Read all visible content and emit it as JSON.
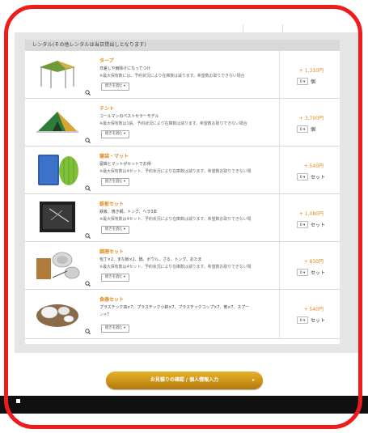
{
  "section": {
    "header": "レンタル(その他レンタルは当日貸出しとなります)"
  },
  "items": [
    {
      "title": "タープ",
      "desc": "日差しや雨除けになってつけ",
      "note": "※最大保有数には、予約状況により在庫数は減ります。希望数お取りできない場合",
      "more_label": "続きを読む ▾",
      "price": "+ 1,310円",
      "qty": "0",
      "unit": "個",
      "image_icon": "tarp-tent-icon"
    },
    {
      "title": "テント",
      "desc": "コールマンのベストセラーモデル",
      "note": "※最大保有数は1張、予約状況により在庫数は減ります。希望数お取りできない場合",
      "more_label": "続きを読む ▾",
      "price": "+ 3,700円",
      "qty": "0",
      "unit": "個",
      "image_icon": "dome-tent-icon"
    },
    {
      "title": "寝袋・マット",
      "desc": "寝袋とマットがセットでお得",
      "note": "※最大保有数は4セット、予約状況により在庫数は減ります。希望数お取りできない場",
      "more_label": "続きを読む ▾",
      "price": "+ 540円",
      "qty": "0",
      "unit": "セット",
      "image_icon": "sleeping-bag-icon"
    },
    {
      "title": "鉄板セット",
      "desc": "鉄板、焼き網、トング、ヘラ3本",
      "note": "※最大保有数は4セット、予約状況により在庫数は減ります。希望数お取りできない場",
      "more_label": "続きを読む ▾",
      "price": "+ 1,080円",
      "qty": "0",
      "unit": "セット",
      "image_icon": "iron-plate-icon"
    },
    {
      "title": "調理セット",
      "desc": "包丁×2、まな板×2、鍋、ボウル、ざる、トング、おたま",
      "note": "※最大保有数は4セット、予約状況により在庫数は減ります。希望数お取りできない場",
      "more_label": "続きを読む ▾",
      "price": "+ 830円",
      "qty": "0",
      "unit": "セット",
      "image_icon": "cookware-icon"
    },
    {
      "title": "食器セット",
      "desc": "プラスチック皿×7、プラスチック小鉢×7、プラスチックコップ×7、箸×7、スプー",
      "note": "ン×7",
      "more_label": "続きを読む ▾",
      "price": "+ 540円",
      "qty": "0",
      "unit": "セット",
      "image_icon": "tableware-icon"
    }
  ],
  "cta": {
    "label": "お見積りの確認 / 個人情報入力",
    "arrow": "▸"
  }
}
